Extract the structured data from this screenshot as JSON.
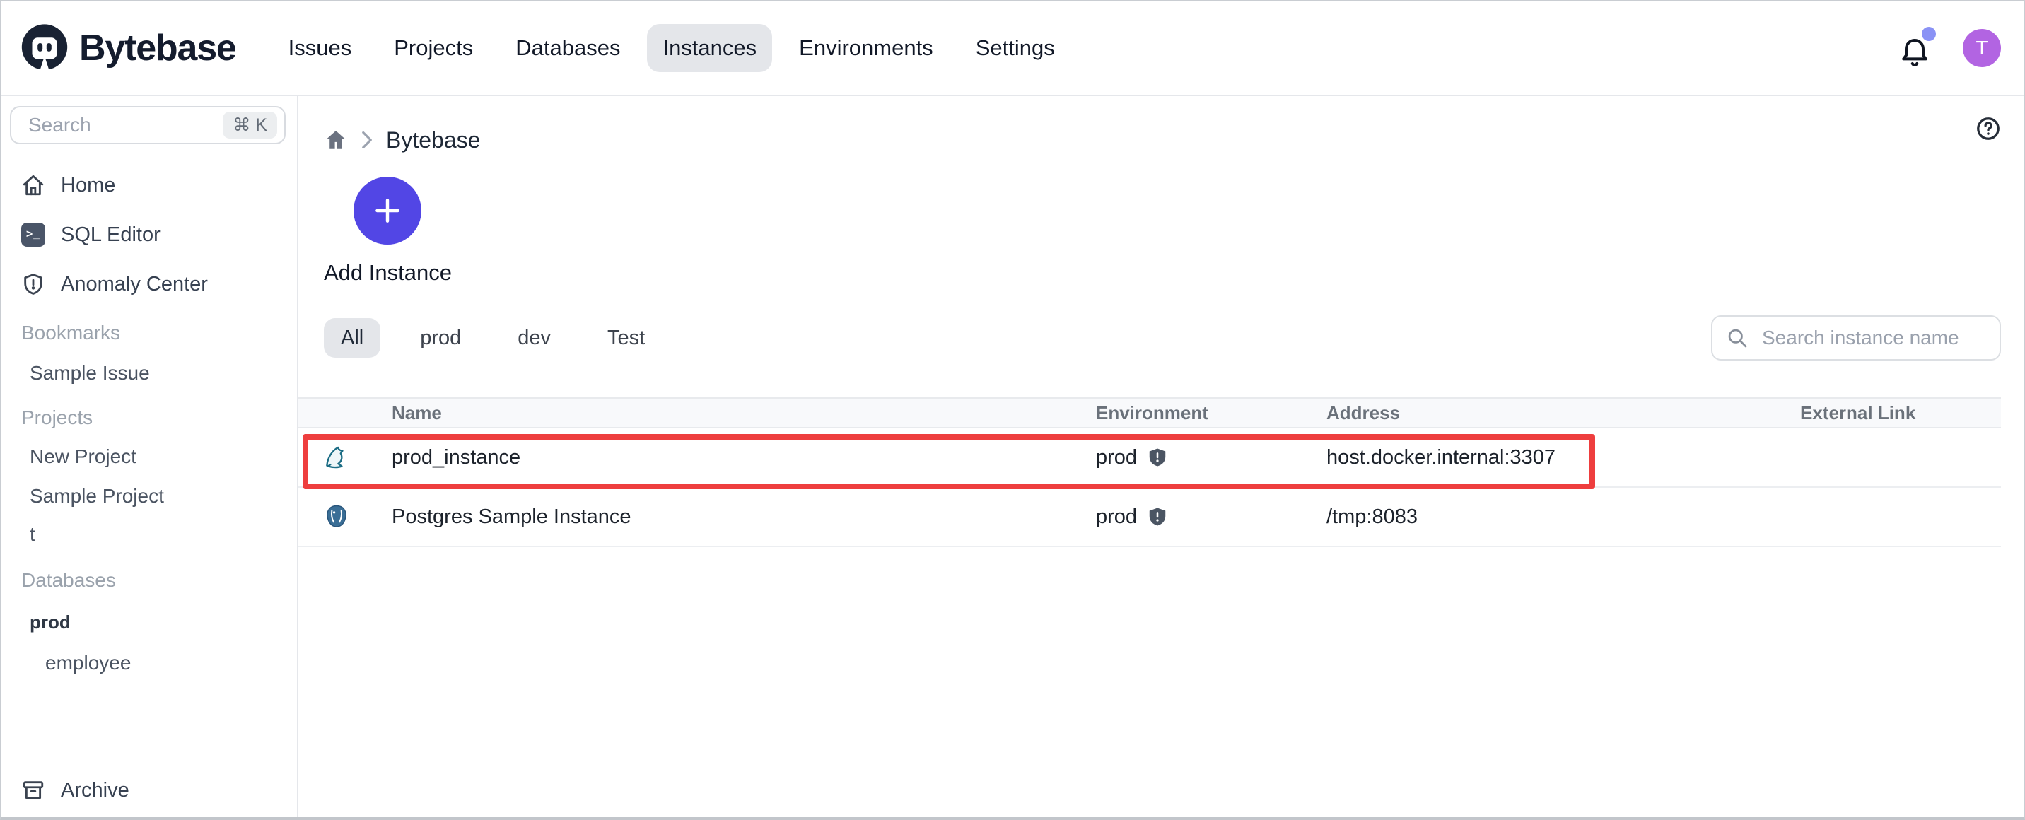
{
  "navbar": {
    "brand": "Bytebase",
    "items": [
      "Issues",
      "Projects",
      "Databases",
      "Instances",
      "Environments",
      "Settings"
    ],
    "active_item": "Instances",
    "avatar_text": "T"
  },
  "sidebar": {
    "search": {
      "placeholder": "Search",
      "shortcut": "⌘ K"
    },
    "nav": {
      "home": "Home",
      "sql_editor": "SQL Editor",
      "anomaly_center": "Anomaly Center"
    },
    "bookmarks": {
      "title": "Bookmarks",
      "items": [
        "Sample Issue"
      ]
    },
    "projects": {
      "title": "Projects",
      "items": [
        "New Project",
        "Sample Project",
        "t"
      ]
    },
    "databases": {
      "title": "Databases",
      "group": "prod",
      "items": [
        "employee"
      ]
    },
    "archive": "Archive"
  },
  "breadcrumb": {
    "root": "Bytebase"
  },
  "instances": {
    "add_button": "Add Instance",
    "filters": [
      "All",
      "prod",
      "dev",
      "Test"
    ],
    "active_filter": "All",
    "search_placeholder": "Search instance name",
    "table": {
      "columns": [
        "Name",
        "Environment",
        "Address",
        "External Link"
      ],
      "rows": [
        {
          "engine": "mysql",
          "name": "prod_instance",
          "environment": "prod",
          "address": "host.docker.internal:3307",
          "external_link": "",
          "highlighted": true
        },
        {
          "engine": "postgres",
          "name": "Postgres Sample Instance",
          "environment": "prod",
          "address": "/tmp:8083",
          "external_link": "",
          "highlighted": false
        }
      ]
    }
  },
  "colors": {
    "accent": "#5246e5",
    "avatar": "#b264e2",
    "notification_dot": "#8a92f5",
    "highlight_red": "#ee3e3e",
    "active_tab_bg": "#e4e6ea"
  }
}
